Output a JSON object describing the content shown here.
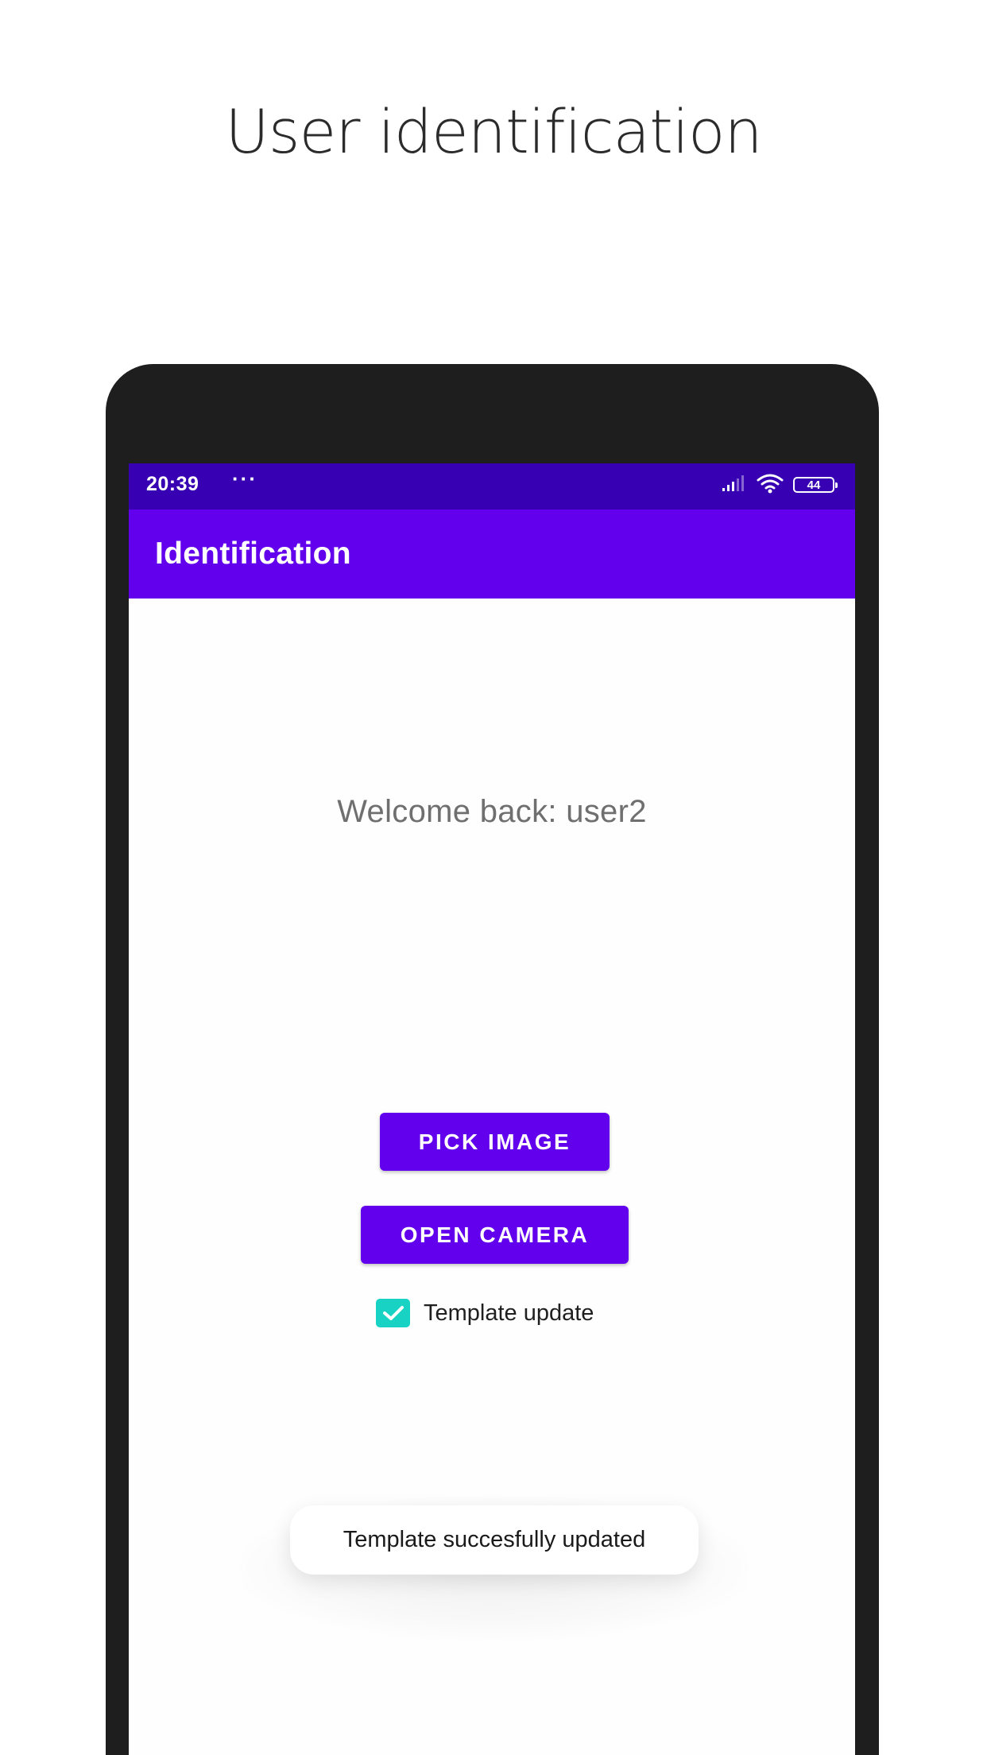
{
  "headline": "User identification",
  "status_bar": {
    "time": "20:39",
    "dots": "···",
    "battery": "44",
    "icons": [
      "signal-icon",
      "wifi-icon",
      "battery-icon"
    ]
  },
  "app_bar": {
    "title": "Identification"
  },
  "main": {
    "welcome_text": "Welcome back: user2",
    "pick_image_label": "PICK IMAGE",
    "open_camera_label": "OPEN CAMERA",
    "template_update": {
      "label": "Template update",
      "checked": true
    }
  },
  "toast": {
    "message": "Template succesfully updated"
  },
  "colors": {
    "status_bar": "#3700b3",
    "primary": "#6200ee",
    "checkbox": "#18d3c3",
    "phone_frame": "#1e1e1e"
  }
}
